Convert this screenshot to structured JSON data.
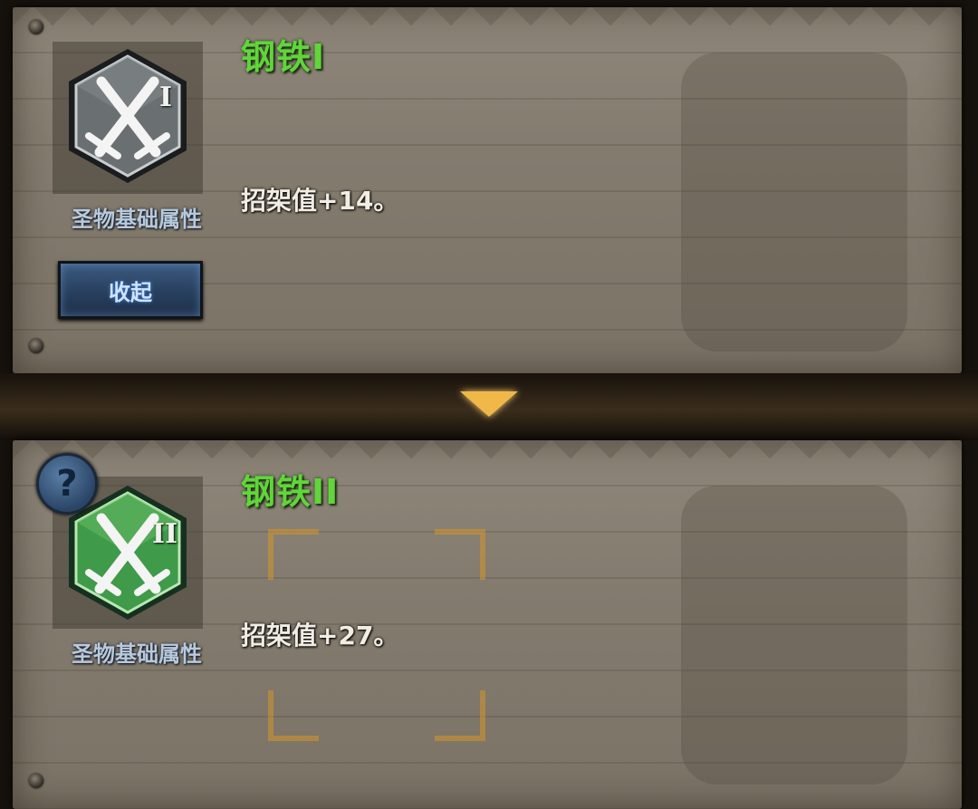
{
  "upper_card": {
    "title": "钢铁Ⅰ",
    "tier": "I",
    "attribute_label": "圣物基础属性",
    "description": "招架值+14。",
    "collapse_label": "收起",
    "badge_color": "#5f6466"
  },
  "lower_card": {
    "title": "钢铁ⅠI",
    "tier": "II",
    "attribute_label": "圣物基础属性",
    "description": "招架值+27。",
    "help_label": "?",
    "badge_color": "#3f9a4a"
  },
  "divider": {
    "icon": "chevron-down-icon",
    "color": "#f0b848"
  }
}
